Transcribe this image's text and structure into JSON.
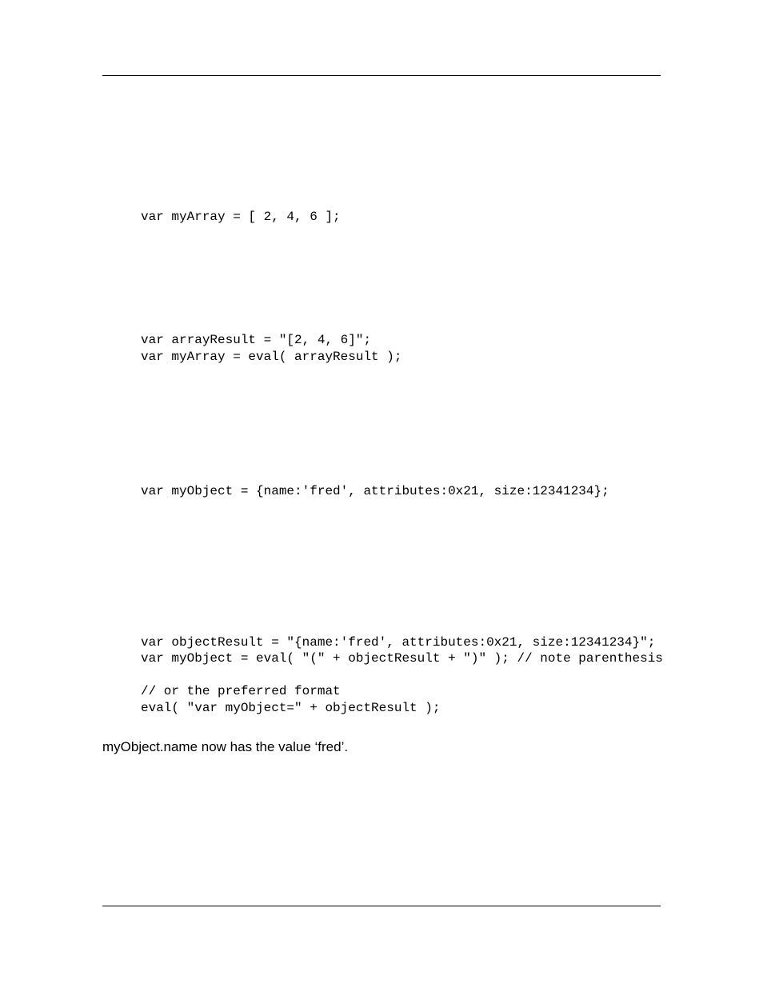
{
  "code": {
    "block1": "var myArray = [ 2, 4, 6 ];",
    "block2_line1": "var arrayResult = \"[2, 4, 6]\";",
    "block2_line2": "var myArray = eval( arrayResult );",
    "block3": "var myObject = {name:'fred', attributes:0x21, size:12341234};",
    "block4_line1": "var objectResult = \"{name:'fred', attributes:0x21, size:12341234}\";",
    "block4_line2": "var myObject = eval( \"(\" + objectResult + \")\" ); // note parenthesis",
    "block4_line3": "",
    "block4_line4": "// or the preferred format",
    "block4_line5": "eval( \"var myObject=\" + objectResult );"
  },
  "prose": {
    "p1": "myObject.name now has the value ‘fred’."
  }
}
